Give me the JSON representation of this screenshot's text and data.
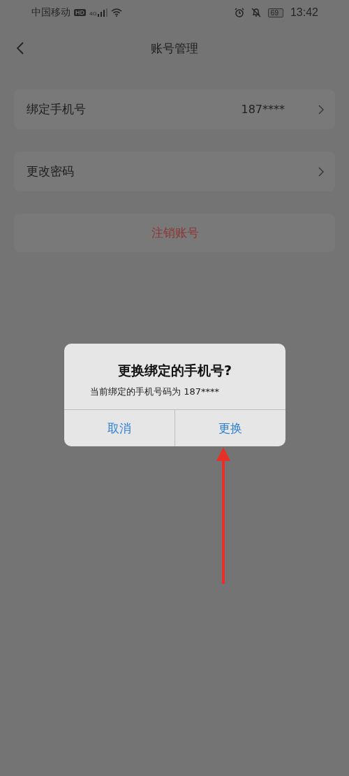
{
  "status_bar": {
    "carrier": "中国移动",
    "hd_badge": "HD",
    "network": "4G",
    "battery": "69",
    "time": "13:42"
  },
  "nav": {
    "title": "账号管理"
  },
  "items": [
    {
      "kind": "link",
      "label": "绑定手机号",
      "value": "187****"
    },
    {
      "kind": "link",
      "label": "更改密码"
    },
    {
      "kind": "danger",
      "label": "注销账号"
    }
  ],
  "dialog": {
    "title": "更换绑定的手机号?",
    "message": "当前绑定的手机号码为 187****",
    "buttons": [
      "取消",
      "更换"
    ]
  }
}
